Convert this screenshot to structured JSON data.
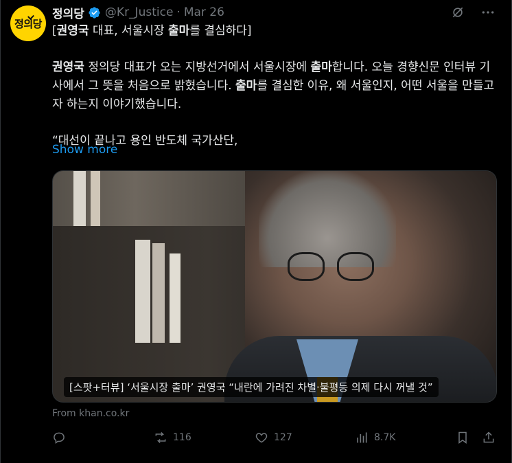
{
  "author": {
    "avatar_text": "정의당",
    "name": "정의당",
    "handle": "@Kr_Justice",
    "separator": "·",
    "date": "Mar 26"
  },
  "tweet": {
    "title_pre": "[",
    "title_bold1": "권영국",
    "title_mid": " 대표, 서울시장 ",
    "title_bold2": "출마",
    "title_post": "를 결심하다]",
    "p2_bold1": "권영국",
    "p2_a": " 정의당 대표가 오는 지방선거에서 서울시장에 ",
    "p2_bold2": "출마",
    "p2_b": "합니다. 오늘 경향신문 인터뷰 기사에서 그 뜻을 처음으로 밝혔습니다. ",
    "p2_bold3": "출마",
    "p2_c": "를 결심한 이유, 왜 서울인지, 어떤 서울을 만들고자 하는지 이야기했습니다.",
    "p3": "“대선이 끝나고 용인 반도체 국가산단,",
    "show_more": "Show more"
  },
  "card": {
    "caption": "[스팟+터뷰] ‘서울시장 출마’ 권영국 “내란에 가려진 차별·불평등 의제 다시 꺼낼 것”",
    "source": "From khan.co.kr"
  },
  "actions": {
    "retweets": "116",
    "likes": "127",
    "views": "8.7K"
  },
  "colors": {
    "accent": "#1d9bf0",
    "avatar_bg": "#ffd400",
    "muted": "#71767b"
  }
}
